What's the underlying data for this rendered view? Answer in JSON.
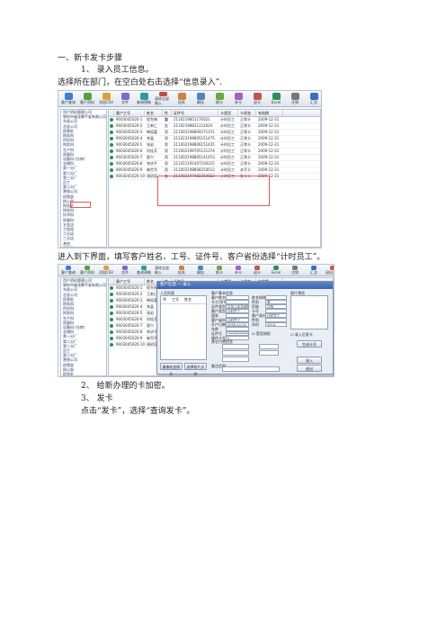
{
  "doc": {
    "heading": "一、新卡发卡步骤",
    "step1": "1、  录入员工信息。",
    "step1_desc": "选择所在部门，在空白处右击选择“信息录入”.",
    "step1_after": "进入到下界面，填写客户姓名、工号、证件号、客户省份选择“计时员工”。",
    "step2": "2、  给新办理的卡加密。",
    "step3": "3、  发卡",
    "step3_desc": "点击“发卡”，选择“查询发卡”。"
  },
  "toolbar": [
    "客户查询",
    "客户资料",
    "添加CSV",
    "文件",
    "查询预制",
    "清除全部制入",
    "挂失",
    "解挂",
    "换卡",
    "补卡",
    "退卡",
    "Excel",
    "注销",
    "汇总",
    "退出系统",
    "广发"
  ],
  "tree1": [
    "用户资料管理公司",
    "铁岭市福龙脚手架有限公司",
    "东昌公司",
    "总务公司",
    "  经营处",
    "  财务科",
    "  供应科",
    "  财务科",
    "  生产科",
    "  质量科",
    "  设备科 (仓库)",
    "  仓储科",
    "  第一分厂",
    "  第二分厂",
    "  第三分厂",
    "  员工",
    "第二分厂",
    "营销公司",
    "  经营部",
    "  核心部",
    "  财务处",
    "  财务科",
    "  技术科",
    "  质量科",
    "  五金店",
    "  工程组",
    "  二分店",
    "  三分店",
    "  其他",
    "保卫科",
    "后勤科"
  ],
  "grid": {
    "headers": [
      "",
      "客户工号",
      "姓名",
      "性别",
      "证件号",
      "卡类型",
      "卡状态",
      "有效期"
    ],
    "rows": [
      [
        "9003045020-1",
        "程冬梅",
        "女",
        "2110219851170021",
        "计时员工",
        "正常卡",
        "2009-12-31"
      ],
      [
        "9003045020-2",
        "王新仁",
        "女",
        "2110219881111402X",
        "计时员工",
        "正常卡",
        "2009-12-31"
      ],
      [
        "9003045020-3",
        "韩振富",
        "男",
        "211002198809271151",
        "计时员工",
        "正常卡",
        "2009-12-31"
      ],
      [
        "9003045020-4",
        "李晶",
        "男",
        "211023198805151475",
        "计时员工",
        "正常卡",
        "2009-12-31"
      ],
      [
        "9003045020-5",
        "张岩",
        "男",
        "211002198806151435",
        "计时员工",
        "正常卡",
        "2009-12-31"
      ],
      [
        "9003045020-6",
        "肖桂芳",
        "男",
        "211002199705121374",
        "计时员工",
        "正常卡",
        "2009-12-31"
      ],
      [
        "9003045020-7",
        "夏兴",
        "男",
        "211002198805141453",
        "计时员工",
        "正常卡",
        "2009-12-31"
      ],
      [
        "9003045020-8",
        "李庆平",
        "男",
        "211411191407100315",
        "计时员工",
        "正常卡",
        "2009-12-31"
      ],
      [
        "9003045020-9",
        "崔世华",
        "男",
        "211002198808250012",
        "计时员工",
        "未写卡",
        "2009-12-31"
      ],
      [
        "9003045020-10",
        "周树蕊",
        "女",
        "211002197402250822",
        "计时员工",
        "发卡卡",
        "2009-12-31"
      ]
    ]
  },
  "dialog": {
    "title": "客户信息 — 录入",
    "left_title": "人员列表",
    "left_cols": [
      "序",
      "工号",
      "姓名"
    ],
    "right_title": "照片预览",
    "group1": "客户基本信息",
    "group2": "其它付费信息",
    "fields": [
      {
        "label": "客户姓名",
        "value": ""
      },
      {
        "label": "卡工/学号",
        "value": ""
      },
      {
        "label": "证件类型",
        "value": "中华人民共和国"
      },
      {
        "label": "客户类型",
        "value": "计时员工"
      },
      {
        "label": "国家",
        "value": ""
      },
      {
        "label": "客户省份",
        "value": "计时员工"
      },
      {
        "label": "开户日期",
        "value": "2009-12-29"
      },
      {
        "label": "年龄",
        "value": ""
      },
      {
        "label": "证件号",
        "value": "**************"
      },
      {
        "label": "操作卡号",
        "value": "0"
      }
    ],
    "right_fields": [
      {
        "label": "姓名简称",
        "value": ""
      },
      {
        "label": "性别",
        "value": "男"
      },
      {
        "label": "民族",
        "value": "汉族"
      },
      {
        "label": "卡号",
        "value": ""
      },
      {
        "label": "客户身份",
        "value": "计时员工"
      },
      {
        "label": "性别",
        "value": ""
      },
      {
        "label": "年份",
        "value": "2014"
      }
    ],
    "checkbox": "是否授权",
    "side_check": "录入后发卡",
    "btn_generate": "生成卡号",
    "btn_ok": "录入",
    "btn_cancel": "退出",
    "btn_save_photo": "摄像机拍照片",
    "btn_load_photo": "选择照片文件",
    "bottom_label": "备注信息："
  },
  "colors": {
    "accent": "#3a64ad",
    "highlight": "#e05a5a"
  }
}
